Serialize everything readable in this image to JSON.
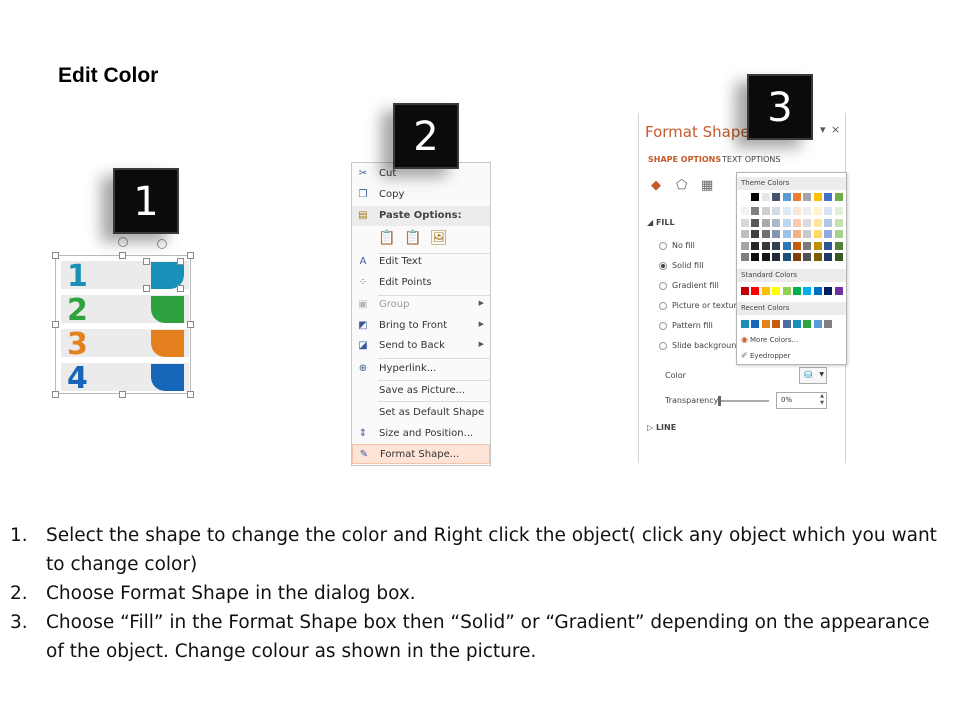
{
  "title": "Edit Color",
  "badges": [
    "1",
    "2",
    "3"
  ],
  "shapes": {
    "items": [
      {
        "number": "1",
        "color": "#1a8fb7"
      },
      {
        "number": "2",
        "color": "#2ea23f"
      },
      {
        "number": "3",
        "color": "#e5801f"
      },
      {
        "number": "4",
        "color": "#1565b8"
      }
    ]
  },
  "context_menu": {
    "items": [
      {
        "label": "Cut",
        "icon": "scissors-icon"
      },
      {
        "label": "Copy",
        "icon": "copy-icon"
      },
      {
        "label": "Paste Options:",
        "icon": "clipboard-icon"
      },
      {
        "label": "Edit Text",
        "icon": "edit-text-icon"
      },
      {
        "label": "Edit Points",
        "icon": "edit-points-icon"
      },
      {
        "label": "Group",
        "icon": "group-icon"
      },
      {
        "label": "Bring to Front",
        "icon": "bring-to-front-icon"
      },
      {
        "label": "Send to Back",
        "icon": "send-to-back-icon"
      },
      {
        "label": "Hyperlink...",
        "icon": "hyperlink-icon"
      },
      {
        "label": "Save as Picture...",
        "icon": ""
      },
      {
        "label": "Set as Default Shape",
        "icon": ""
      },
      {
        "label": "Size and Position...",
        "icon": "size-position-icon"
      },
      {
        "label": "Format Shape...",
        "icon": "format-shape-icon"
      }
    ]
  },
  "format_pane": {
    "title": "Format Shape",
    "tabs": [
      "SHAPE OPTIONS",
      "TEXT OPTIONS"
    ],
    "fill_section": "FILL",
    "fill_options": [
      "No fill",
      "Solid fill",
      "Gradient fill",
      "Picture or texture fill",
      "Pattern fill",
      "Slide background fill"
    ],
    "fill_options_visible": [
      "No fill",
      "Solid fill",
      "Gradient fill",
      "Picture or texture",
      "Pattern fill",
      "Slide background"
    ],
    "selected_fill": "Solid fill",
    "color_label": "Color",
    "transparency_label": "Transparency",
    "transparency_value": "0%",
    "line_section": "LINE",
    "palette": {
      "theme_colors_label": "Theme Colors",
      "standard_colors_label": "Standard Colors",
      "recent_colors_label": "Recent Colors",
      "more_colors": "More Colors...",
      "eyedropper": "Eyedropper",
      "theme_top": [
        "#ffffff",
        "#000000",
        "#e7e6e6",
        "#44546a",
        "#5b9bd5",
        "#ed7d31",
        "#a5a5a5",
        "#ffc000",
        "#4472c4",
        "#70ad47"
      ],
      "theme_shades": [
        [
          "#f2f2f2",
          "#7f7f7f",
          "#d0cece",
          "#d6dce4",
          "#deebf6",
          "#fbe5d5",
          "#ededed",
          "#fff2cc",
          "#dae3f3",
          "#e2efd9"
        ],
        [
          "#d8d8d8",
          "#595959",
          "#aeaaaa",
          "#adb9ca",
          "#bdd7ee",
          "#f7cbac",
          "#dbdbdb",
          "#fee599",
          "#b4c6e7",
          "#c5e0b3"
        ],
        [
          "#bfbfbf",
          "#3f3f3f",
          "#757070",
          "#8496b0",
          "#9cc3e5",
          "#f4b183",
          "#c9c9c9",
          "#ffd965",
          "#8eaadb",
          "#a8d08d"
        ],
        [
          "#a5a5a5",
          "#262626",
          "#3a3838",
          "#323f4f",
          "#2e75b5",
          "#c55a11",
          "#7b7b7b",
          "#bf9000",
          "#2f5496",
          "#538135"
        ],
        [
          "#7f7f7f",
          "#0c0c0c",
          "#171616",
          "#222a35",
          "#1e4e79",
          "#833c0b",
          "#525252",
          "#7f6000",
          "#1f3864",
          "#375623"
        ]
      ],
      "standard": [
        "#c00000",
        "#ff0000",
        "#ffc000",
        "#ffff00",
        "#92d050",
        "#00b050",
        "#00b0f0",
        "#0070c0",
        "#002060",
        "#7030a0"
      ],
      "recent": [
        "#1a8fb7",
        "#1565b8",
        "#e5801f",
        "#c55a11",
        "#4a6fa5",
        "#1a8fb7",
        "#2ea23f",
        "#5b9bd5",
        "#808080"
      ]
    }
  },
  "instructions": [
    {
      "num": "1.",
      "text": "Select the shape to change the color and Right click the object( click any object which you want to change color)"
    },
    {
      "num": "2.",
      "text": "Choose Format Shape in the dialog box."
    },
    {
      "num": "3.",
      "text": "Choose “Fill” in the Format Shape box then “Solid” or “Gradient” depending on the appearance of the object. Change colour as shown in the picture."
    }
  ]
}
